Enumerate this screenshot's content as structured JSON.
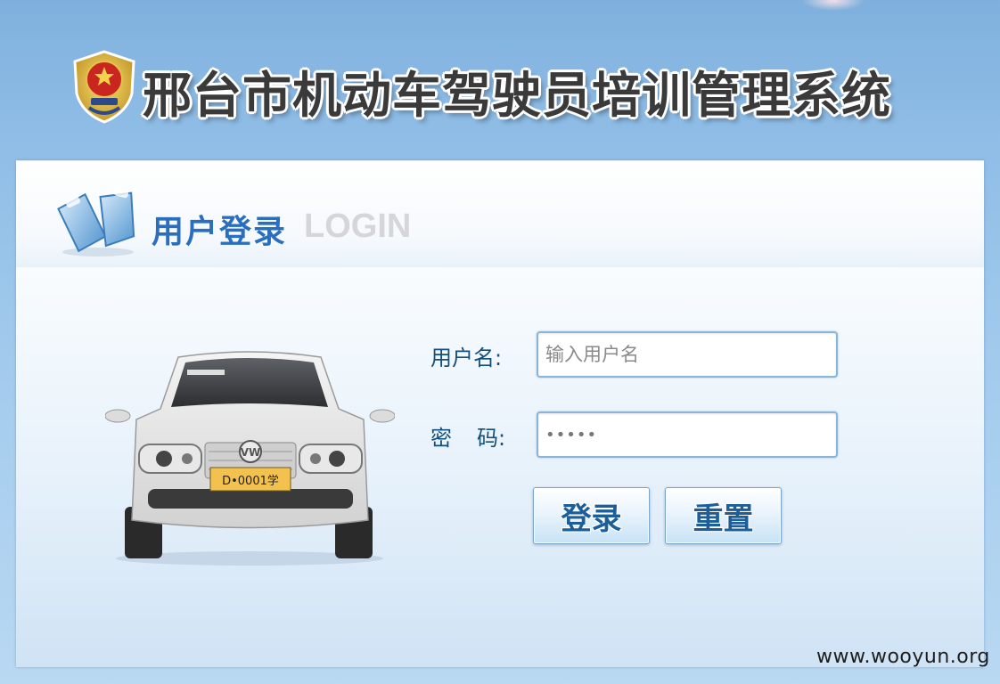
{
  "header": {
    "system_title": "邢台市机动车驾驶员培训管理系统"
  },
  "login_panel": {
    "title": "用户登录",
    "subtitle": "LOGIN",
    "username_label": "用户名:",
    "username_placeholder": "输入用户名",
    "username_value": "",
    "password_label_left": "密",
    "password_label_right": "码:",
    "password_value": "•••••",
    "login_button": "登录",
    "reset_button": "重置"
  },
  "car": {
    "plate": "D•0001学"
  },
  "watermark": "www.wooyun.org",
  "colors": {
    "title_blue": "#2a6fbf",
    "label_blue": "#134f7b",
    "background_blue": "#8fbde6"
  }
}
